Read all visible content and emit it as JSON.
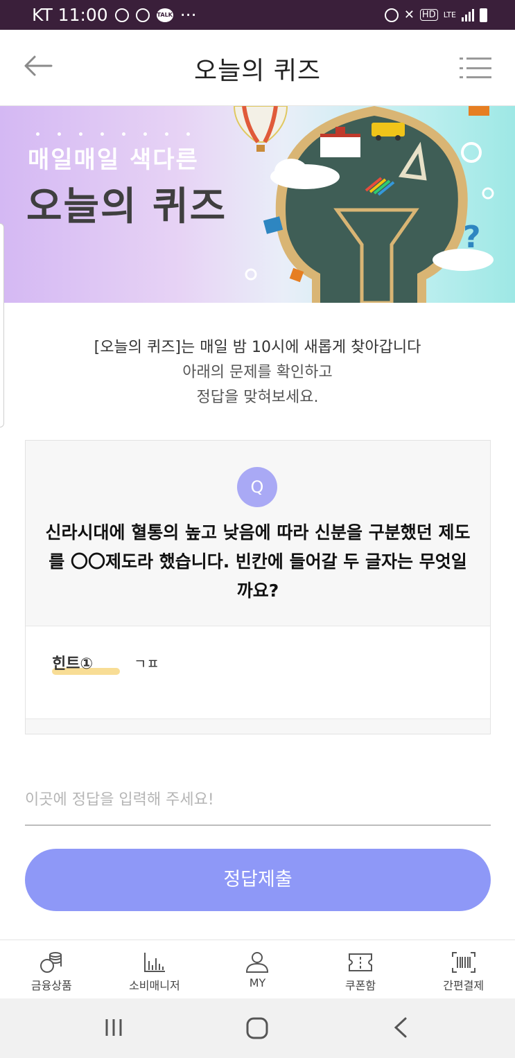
{
  "status_bar": {
    "carrier_time": "KT 11:00",
    "more": "···",
    "talk": "TALK",
    "hd": "HD",
    "lte": "LTE"
  },
  "header": {
    "title": "오늘의 퀴즈"
  },
  "banner": {
    "subtitle": "매일매일 색다른",
    "title": "오늘의 퀴즈"
  },
  "intro": {
    "line1": "[오늘의 퀴즈]는 매일 밤 10시에 새롭게 찾아갑니다",
    "line2": "아래의 문제를 확인하고",
    "line3": "정답을 맞혀보세요."
  },
  "quiz": {
    "badge": "Q",
    "question": "신라시대에 혈통의 높고 낮음에 따라 신분을 구분했던 제도를 〇〇제도라 했습니다. 빈칸에 들어갈 두 글자는 무엇일까요?",
    "hint_label": "힌트①",
    "hint_value": "ㄱㅍ"
  },
  "answer": {
    "placeholder": "이곳에 정답을 입력해 주세요!",
    "value": ""
  },
  "submit": {
    "label": "정답제출"
  },
  "bottom_nav": {
    "items": [
      {
        "label": "금융상품",
        "icon": "coins-icon"
      },
      {
        "label": "소비매니저",
        "icon": "bar-chart-icon"
      },
      {
        "label": "MY",
        "icon": "person-icon"
      },
      {
        "label": "쿠폰함",
        "icon": "ticket-icon"
      },
      {
        "label": "간편결제",
        "icon": "barcode-icon"
      }
    ]
  },
  "colors": {
    "status_bar": "#3a1f3a",
    "accent": "#8e98f7",
    "badge": "#a9a9f5"
  }
}
